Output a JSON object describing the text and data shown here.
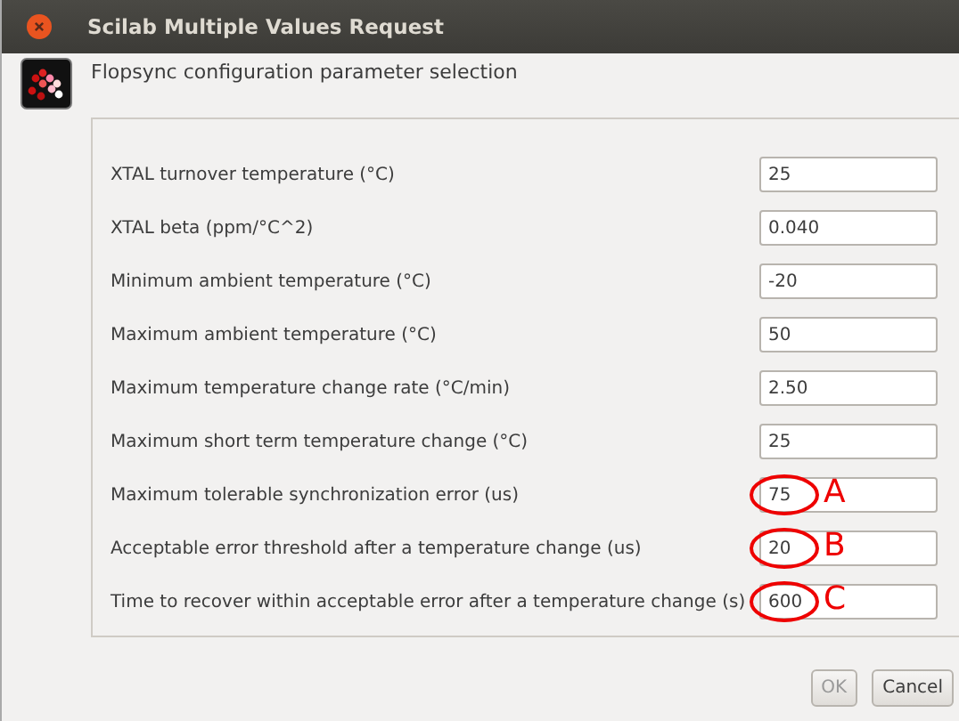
{
  "window": {
    "title": "Scilab Multiple Values Request"
  },
  "header": "Flopsync configuration parameter selection",
  "parameters": [
    {
      "label": "XTAL turnover temperature (°C)",
      "value": "25"
    },
    {
      "label": "XTAL beta (ppm/°C^2)",
      "value": "0.040"
    },
    {
      "label": "Minimum ambient temperature (°C)",
      "value": "-20"
    },
    {
      "label": "Maximum ambient temperature (°C)",
      "value": "50"
    },
    {
      "label": "Maximum temperature change rate (°C/min)",
      "value": "2.50"
    },
    {
      "label": "Maximum short term temperature change (°C)",
      "value": "25"
    },
    {
      "label": "Maximum tolerable synchronization error (us)",
      "value": "75",
      "annotation": "A"
    },
    {
      "label": "Acceptable error threshold after a temperature change (us)",
      "value": "20",
      "annotation": "B"
    },
    {
      "label": "Time to recover within acceptable error after a temperature change (s)",
      "value": "600",
      "annotation": "C"
    }
  ],
  "buttons": [
    {
      "label": "OK",
      "disabled": true
    },
    {
      "label": "Cancel",
      "disabled": false
    }
  ]
}
